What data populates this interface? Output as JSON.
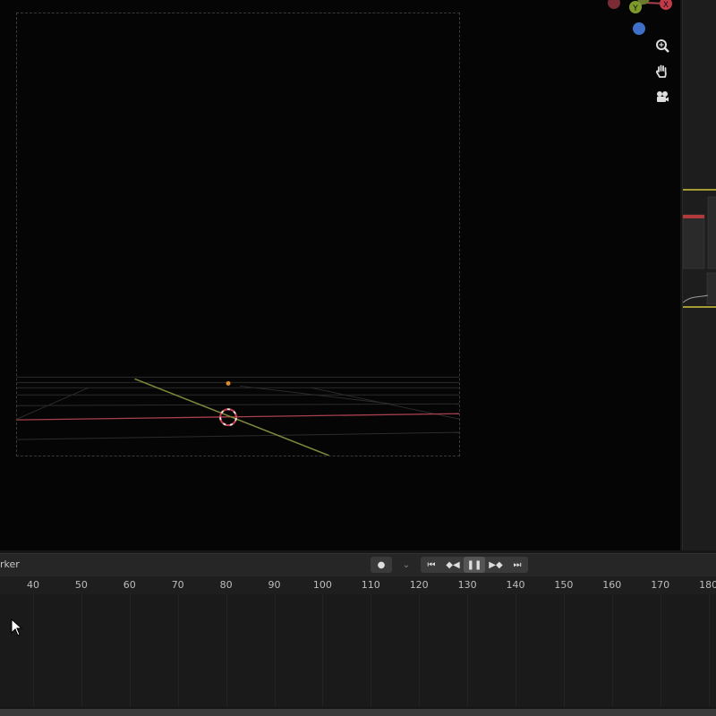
{
  "viewport": {
    "gizmo_axes": {
      "y": "Y",
      "x": "X"
    },
    "gizmo_tools": [
      "zoom-icon",
      "hand-pan-icon",
      "camera-icon"
    ]
  },
  "timeline": {
    "marker_label": "rker",
    "transport": [
      "record-icon",
      "chevron-down-icon",
      "jump-start-icon",
      "prev-keyframe-icon",
      "pause-icon",
      "next-keyframe-icon",
      "jump-end-icon"
    ],
    "frames": [
      "40",
      "50",
      "60",
      "70",
      "80",
      "90",
      "100",
      "110",
      "120",
      "130",
      "140",
      "150",
      "160",
      "170",
      "180"
    ]
  },
  "colors": {
    "x_axis": "#a8404e",
    "y_axis": "#7d8a3a",
    "gizmo_blue": "#3f6fc8",
    "origin": "#e08a2a",
    "selection": "#d4c33a"
  }
}
